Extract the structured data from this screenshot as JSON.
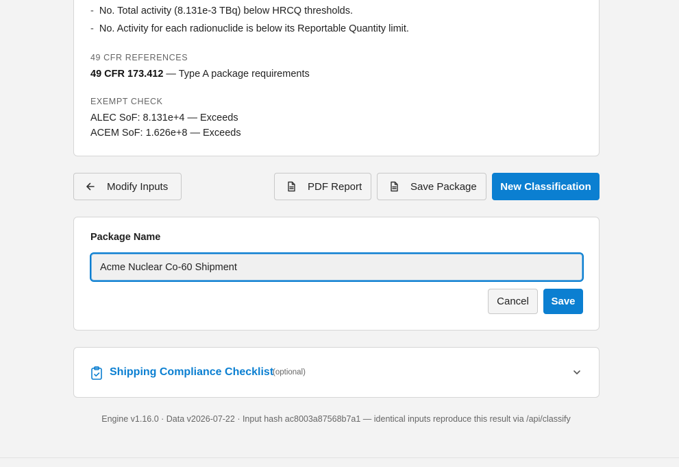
{
  "results": {
    "bullets": [
      {
        "dash": "-",
        "text": "No. Total activity (8.131e-3 TBq) below HRCQ thresholds."
      },
      {
        "dash": "-",
        "text": "No. Activity for each radionuclide is below its Reportable Quantity limit."
      }
    ],
    "cfr_heading": "49 CFR REFERENCES",
    "cfr_ref_code": "49 CFR 173.412",
    "cfr_ref_desc": " — Type A package requirements",
    "exempt_heading": "EXEMPT CHECK",
    "alec_line": "ALEC SoF: 8.131e+4 — Exceeds",
    "acem_line": "ACEM SoF: 1.626e+8 — Exceeds"
  },
  "actions": {
    "modify_label": "Modify Inputs",
    "pdf_label": "PDF Report",
    "save_package_label": "Save Package",
    "new_label": "New Classification"
  },
  "package": {
    "label": "Package Name",
    "value": "Acme Nuclear Co-60 Shipment",
    "cancel_label": "Cancel",
    "save_label": "Save"
  },
  "checklist": {
    "title": "Shipping Compliance Checklist",
    "optional": "(optional)"
  },
  "footer": {
    "text": "Engine v1.16.0 · Data v2026-07-22 · Input hash ac8003a87568b7a1 — identical inputs reproduce this result via /api/classify"
  },
  "colors": {
    "accent": "#0b7fd1",
    "background": "#f3f3f3",
    "card": "#ffffff"
  },
  "icons": {
    "modify": "arrow-left-icon",
    "pdf": "document-icon",
    "save_package": "document-icon",
    "checklist": "clipboard-check-icon",
    "expand": "chevron-down-icon"
  }
}
